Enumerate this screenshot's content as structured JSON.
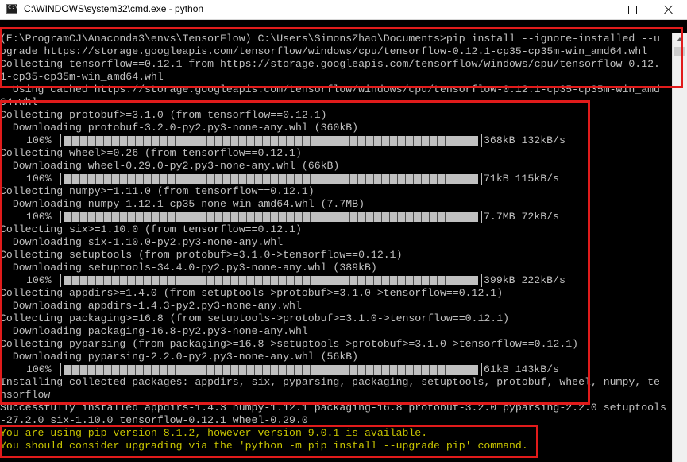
{
  "window": {
    "title": "C:\\WINDOWS\\system32\\cmd.exe - python"
  },
  "console": {
    "lines": [
      "(E:\\ProgramCJ\\Anaconda3\\envs\\TensorFlow) C:\\Users\\SimonsZhao\\Documents>pip install --ignore-installed --u",
      "pgrade https://storage.googleapis.com/tensorflow/windows/cpu/tensorflow-0.12.1-cp35-cp35m-win_amd64.whl",
      "Collecting tensorflow==0.12.1 from https://storage.googleapis.com/tensorflow/windows/cpu/tensorflow-0.12.",
      "1-cp35-cp35m-win_amd64.whl",
      "  Using cached https://storage.googleapis.com/tensorflow/windows/cpu/tensorflow-0.12.1-cp35-cp35m-win_amd",
      "64.whl",
      "Collecting protobuf>=3.1.0 (from tensorflow==0.12.1)",
      "  Downloading protobuf-3.2.0-py2.py3-none-any.whl (360kB)",
      "Collecting wheel>=0.26 (from tensorflow==0.12.1)",
      "  Downloading wheel-0.29.0-py2.py3-none-any.whl (66kB)",
      "Collecting numpy>=1.11.0 (from tensorflow==0.12.1)",
      "  Downloading numpy-1.12.1-cp35-none-win_amd64.whl (7.7MB)",
      "Collecting six>=1.10.0 (from tensorflow==0.12.1)",
      "  Downloading six-1.10.0-py2.py3-none-any.whl",
      "Collecting setuptools (from protobuf>=3.1.0->tensorflow==0.12.1)",
      "  Downloading setuptools-34.4.0-py2.py3-none-any.whl (389kB)",
      "Collecting appdirs>=1.4.0 (from setuptools->protobuf>=3.1.0->tensorflow==0.12.1)",
      "  Downloading appdirs-1.4.3-py2.py3-none-any.whl",
      "Collecting packaging>=16.8 (from setuptools->protobuf>=3.1.0->tensorflow==0.12.1)",
      "  Downloading packaging-16.8-py2.py3-none-any.whl",
      "Collecting pyparsing (from packaging>=16.8->setuptools->protobuf>=3.1.0->tensorflow==0.12.1)",
      "  Downloading pyparsing-2.2.0-py2.py3-none-any.whl (56kB)",
      "Installing collected packages: appdirs, six, pyparsing, packaging, setuptools, protobuf, wheel, numpy, te",
      "nsorflow",
      "Successfully installed appdirs-1.4.3 numpy-1.12.1 packaging-16.8 protobuf-3.2.0 pyparsing-2.2.0 setuptools",
      "-27.2.0 six-1.10.0 tensorflow-0.12.1 wheel-0.29.0",
      "You are using pip version 8.1.2, however version 9.0.1 is available.",
      "You should consider upgrading via the 'python -m pip install --upgrade pip' command."
    ],
    "progress": [
      {
        "percent": "100%",
        "value": 1.0,
        "stats": "368kB 132kB/s"
      },
      {
        "percent": "100%",
        "value": 1.0,
        "stats": "71kB 115kB/s"
      },
      {
        "percent": "100%",
        "value": 1.0,
        "stats": "7.7MB 72kB/s"
      },
      {
        "percent": "100%",
        "value": 1.0,
        "stats": "399kB 222kB/s"
      },
      {
        "percent": "100%",
        "value": 1.0,
        "stats": "61kB 143kB/s"
      }
    ]
  },
  "colors": {
    "console_text": "#c0c0c0",
    "warning_text": "#c7c300",
    "highlight_box": "#e11b1b",
    "background": "#000000"
  },
  "icons": {
    "app": "cmd-icon",
    "minimize": "minimize-icon",
    "maximize": "maximize-icon",
    "close": "close-icon",
    "scroll_up": "scroll-up-arrow-icon"
  }
}
